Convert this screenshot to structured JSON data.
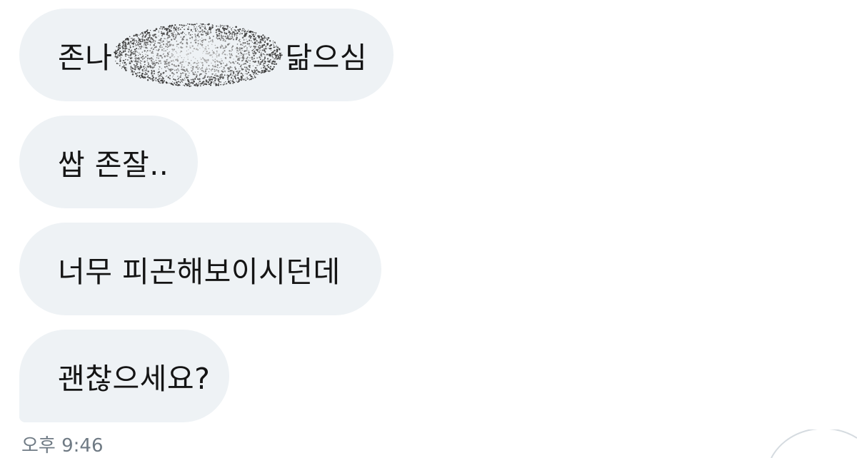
{
  "messages": [
    {
      "before_redaction": "존나",
      "after_redaction": "닮으심"
    },
    {
      "text": "쌉 존잘.."
    },
    {
      "text": "너무 피곤해보이시던데"
    },
    {
      "text": "괜찮으세요?"
    }
  ],
  "timestamp": "오후 9:46",
  "colors": {
    "bubble_bg": "#eef2f5",
    "text": "#141414",
    "timestamp": "#6f7a84"
  }
}
